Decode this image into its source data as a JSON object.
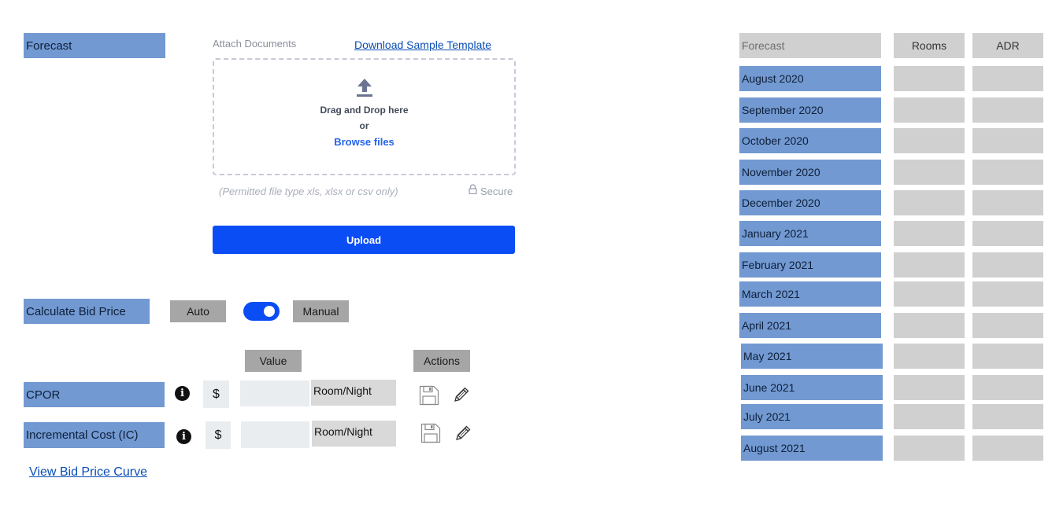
{
  "forecast_label": "Forecast",
  "attach": {
    "title": "Attach Documents",
    "download_link": "Download Sample Template",
    "drop_text": "Drag and Drop here",
    "or_text": "or",
    "browse_text": "Browse files",
    "permitted_text": "(Permitted file type xls, xlsx or csv only)",
    "secure_text": "Secure",
    "upload_button": "Upload"
  },
  "bid": {
    "label": "Calculate Bid Price",
    "auto_label": "Auto",
    "manual_label": "Manual",
    "toggle_on": true
  },
  "costs": {
    "value_header": "Value",
    "actions_header": "Actions",
    "rows": [
      {
        "label": "CPOR",
        "currency": "$",
        "value": "",
        "unit": "Room/Night"
      },
      {
        "label": "Incremental Cost (IC)",
        "currency": "$",
        "value": "",
        "unit": "Room/Night"
      }
    ]
  },
  "view_curve_link": "View Bid Price Curve",
  "forecast_table": {
    "headers": [
      "Forecast",
      "Rooms",
      "ADR"
    ],
    "rows": [
      {
        "month": "August 2020",
        "rooms": "",
        "adr": ""
      },
      {
        "month": "September 2020",
        "rooms": "",
        "adr": ""
      },
      {
        "month": "October 2020",
        "rooms": "",
        "adr": ""
      },
      {
        "month": "November 2020",
        "rooms": "",
        "adr": ""
      },
      {
        "month": "December 2020",
        "rooms": "",
        "adr": ""
      },
      {
        "month": "January 2021",
        "rooms": "",
        "adr": ""
      },
      {
        "month": "February 2021",
        "rooms": "",
        "adr": ""
      },
      {
        "month": "March 2021",
        "rooms": "",
        "adr": ""
      },
      {
        "month": "April 2021",
        "rooms": "",
        "adr": ""
      },
      {
        "month": "May 2021",
        "rooms": "",
        "adr": ""
      },
      {
        "month": "June 2021",
        "rooms": "",
        "adr": ""
      },
      {
        "month": "July 2021",
        "rooms": "",
        "adr": ""
      },
      {
        "month": "August 2021",
        "rooms": "",
        "adr": ""
      }
    ]
  },
  "colors": {
    "label_blue": "#7299d1",
    "primary_blue": "#0b4df5",
    "cell_gray": "#d0d0d0",
    "header_gray": "#a6a6a6"
  },
  "icons": [
    "upload-arrow-icon",
    "lock-icon",
    "info-icon",
    "save-icon",
    "edit-pencil-icon"
  ]
}
